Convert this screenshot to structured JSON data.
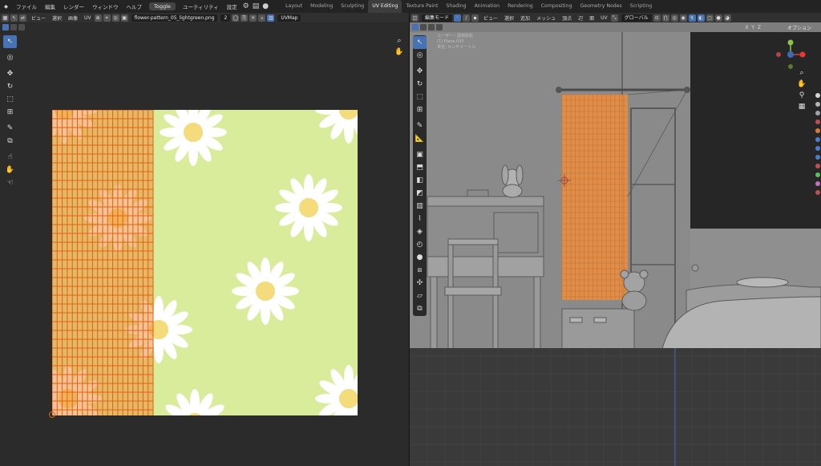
{
  "menu": {
    "file": "ファイル",
    "edit": "編集",
    "render": "レンダー",
    "window": "ウィンドウ",
    "help": "ヘルプ",
    "toggle": "Toggle",
    "utility": "ユーティリティ",
    "settings": "設定"
  },
  "workspaces": [
    "Layout",
    "Modeling",
    "Sculpting",
    "UV Editing",
    "Texture Paint",
    "Shading",
    "Animation",
    "Rendering",
    "Compositing",
    "Geometry Nodes",
    "Scripting"
  ],
  "active_workspace": "UV Editing",
  "uv_editor": {
    "header": {
      "view": "ビュー",
      "select": "選択",
      "image": "画像",
      "uv": "UV",
      "image_name": "flower-pattern_05_lightgreen.png",
      "users": "2",
      "uvmap": "UVMap"
    },
    "tools": [
      "select-box",
      "cursor",
      "move",
      "rotate",
      "scale",
      "transform",
      "annotate",
      "rip",
      "grab",
      "relax",
      "pinch"
    ],
    "flower_petal_color": "#ffffff",
    "flower_center_color": "#f4dc7c",
    "texture_color": "#d9ec9b",
    "mesh_color": "#ef8e3d"
  },
  "viewport": {
    "header": {
      "mode": "編集モード",
      "view": "ビュー",
      "select": "選択",
      "add": "追加",
      "mesh": "メッシュ",
      "vertex": "頂点",
      "edge": "辺",
      "face": "面",
      "uv": "UV",
      "orientation": "グローバル",
      "options": "オプション"
    },
    "axes": {
      "x": "X",
      "y": "Y",
      "z": "Z"
    },
    "overlay_text": [
      "ユーザー・透視投影",
      "(1) Plane.035",
      "単位: センチメートル"
    ]
  }
}
